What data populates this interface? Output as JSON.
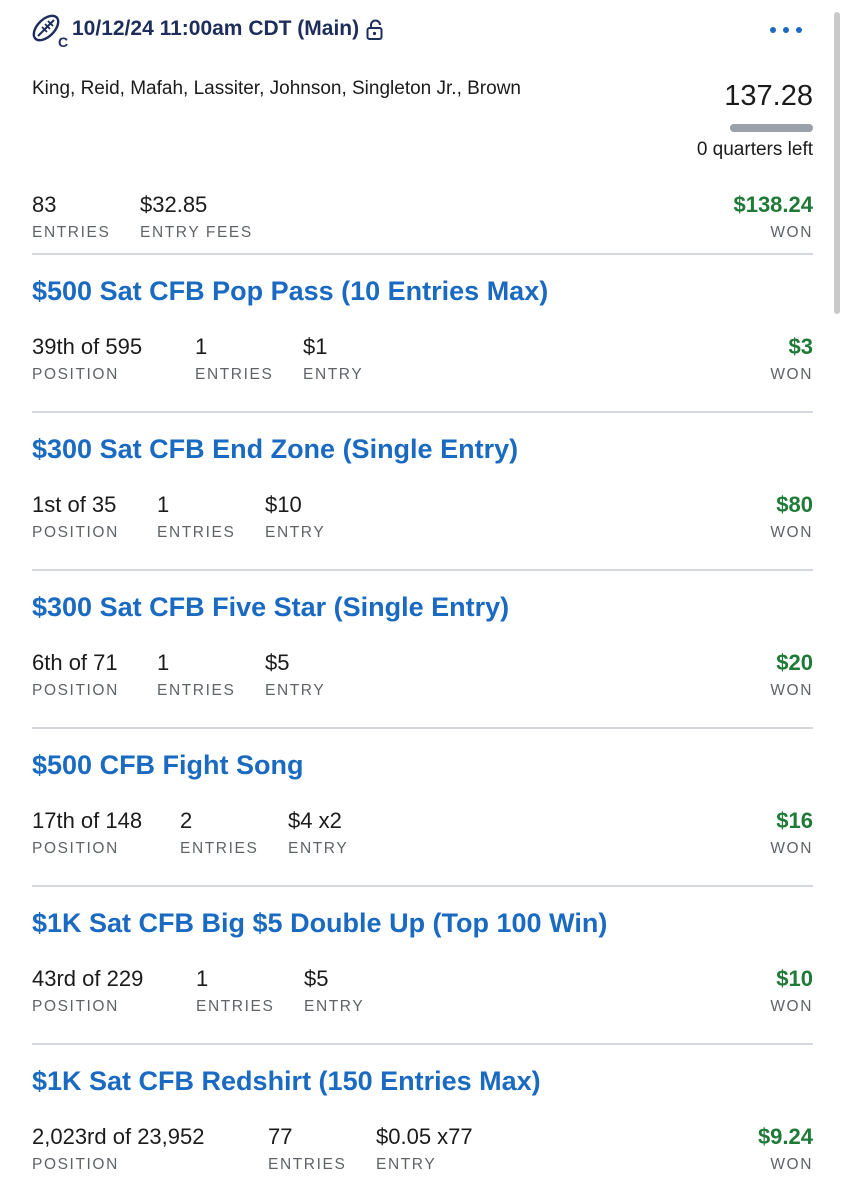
{
  "header": {
    "title": "10/12/24 11:00am CDT (Main)",
    "sport_icon": "football-icon",
    "lock_icon": "unlocked-icon",
    "more_icon": "more-horizontal-icon"
  },
  "summary": {
    "players": "King, Reid, Mafah, Lassiter, Johnson, Singleton Jr., Brown",
    "score": "137.28",
    "time_left": "0 quarters left",
    "progress_fraction": 1.0,
    "entries_value": "83",
    "entries_label": "ENTRIES",
    "fees_value": "$32.85",
    "fees_label": "ENTRY FEES",
    "won_value": "$138.24",
    "won_label": "WON"
  },
  "colors": {
    "accent": "#1a6ac2",
    "win": "#1f7a37",
    "title": "#1d2d5c"
  },
  "contests": [
    {
      "title": "$500 Sat CFB Pop Pass (10 Entries Max)",
      "position": "39th of 595",
      "position_label": "POSITION",
      "entries": "1",
      "entries_label": "ENTRIES",
      "entry": "$1",
      "entry_label": "ENTRY",
      "won": "$3",
      "won_label": "WON"
    },
    {
      "title": "$300 Sat CFB End Zone (Single Entry)",
      "position": "1st of 35",
      "position_label": "POSITION",
      "entries": "1",
      "entries_label": "ENTRIES",
      "entry": "$10",
      "entry_label": "ENTRY",
      "won": "$80",
      "won_label": "WON"
    },
    {
      "title": "$300 Sat CFB Five Star (Single Entry)",
      "position": "6th of 71",
      "position_label": "POSITION",
      "entries": "1",
      "entries_label": "ENTRIES",
      "entry": "$5",
      "entry_label": "ENTRY",
      "won": "$20",
      "won_label": "WON"
    },
    {
      "title": "$500 CFB Fight Song",
      "position": "17th of 148",
      "position_label": "POSITION",
      "entries": "2",
      "entries_label": "ENTRIES",
      "entry": "$4 x2",
      "entry_label": "ENTRY",
      "won": "$16",
      "won_label": "WON"
    },
    {
      "title": "$1K Sat CFB Big $5 Double Up (Top 100 Win)",
      "position": "43rd of 229",
      "position_label": "POSITION",
      "entries": "1",
      "entries_label": "ENTRIES",
      "entry": "$5",
      "entry_label": "ENTRY",
      "won": "$10",
      "won_label": "WON"
    },
    {
      "title": "$1K Sat CFB Redshirt (150 Entries Max)",
      "position": "2,023rd of 23,952",
      "position_label": "POSITION",
      "entries": "77",
      "entries_label": "ENTRIES",
      "entry": "$0.05 x77",
      "entry_label": "ENTRY",
      "won": "$9.24",
      "won_label": "WON"
    }
  ]
}
